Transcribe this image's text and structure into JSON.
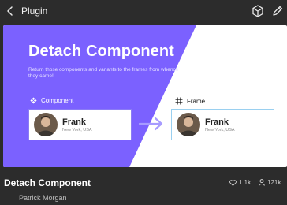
{
  "topbar": {
    "back_icon": "chevron-left-icon",
    "title": "Plugin",
    "actions": [
      "plugin-icon",
      "edit-icon"
    ]
  },
  "cover": {
    "headline": "Detach Component",
    "subtitle": "Return those components and variants to the frames from whence they came!",
    "component_label": "Component",
    "frame_label": "Frame",
    "card_left": {
      "name": "Frank",
      "location": "New York, USA"
    },
    "card_right": {
      "name": "Frank",
      "location": "New York, USA"
    },
    "colors": {
      "purple": "#7b61ff",
      "white": "#ffffff",
      "arrow": "#a79bff"
    }
  },
  "footer": {
    "plugin_name": "Detach Component",
    "author": "Patrick Morgan",
    "likes": "1.1k",
    "users": "121k"
  }
}
